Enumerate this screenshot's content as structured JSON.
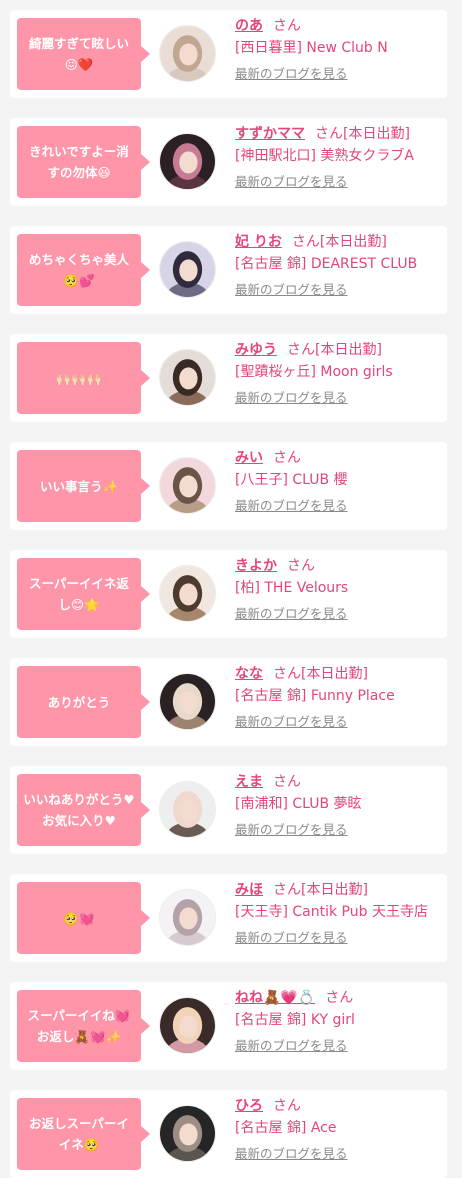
{
  "entries": [
    {
      "comment": "綺麗すぎて眩しい😖❤️",
      "name": "のあ",
      "status": "さん",
      "shop": "[西日暮里] New Club N",
      "blog_link": "最新のブログを見る",
      "avatar_colors": [
        "#e9ddd6",
        "#d9c8bd",
        "#c1a692"
      ]
    },
    {
      "comment": "きれいですよー消すの勿体😆",
      "name": "すずかママ",
      "status": "さん[本日出勤]",
      "shop": "[神田駅北口] 美熟女クラブA",
      "blog_link": "最新のブログを見る",
      "avatar_colors": [
        "#2b2026",
        "#5a3442",
        "#c77b92"
      ]
    },
    {
      "comment": "めちゃくちゃ美人🥺💕",
      "name": "妃 りお",
      "status": "さん[本日出勤]",
      "shop": "[名古屋 錦] DEAREST CLUB",
      "blog_link": "最新のブログを見る",
      "avatar_colors": [
        "#d8d4e8",
        "#6d6a86",
        "#2f2a3c"
      ]
    },
    {
      "comment": "🙌🏻🙌🏻🙌🏻",
      "name": "みゆう",
      "status": "さん[本日出勤]",
      "shop": "[聖蹟桜ヶ丘] Moon girls",
      "blog_link": "最新のブログを見る",
      "avatar_colors": [
        "#e4dcd6",
        "#8a6a58",
        "#3a2a24"
      ]
    },
    {
      "comment": "いい事言う✨",
      "name": "みい",
      "status": "さん",
      "shop": "[八王子] CLUB 櫻",
      "blog_link": "最新のブログを見る",
      "avatar_colors": [
        "#f2d8dd",
        "#b89e86",
        "#6a5447"
      ]
    },
    {
      "comment": "スーパーイイネ返し😊🌟",
      "name": "きよか",
      "status": "さん",
      "shop": "[柏] THE Velours",
      "blog_link": "最新のブログを見る",
      "avatar_colors": [
        "#efe7e0",
        "#a7876c",
        "#4e3a2e"
      ]
    },
    {
      "comment": "ありがとう",
      "name": "なな",
      "status": "さん[本日出勤]",
      "shop": "[名古屋 錦] Funny Place",
      "blog_link": "最新のブログを見る",
      "avatar_colors": [
        "#2a2222",
        "#9e8270",
        "#e7d9cc"
      ]
    },
    {
      "comment": "いいねありがとう♥お気に入り♥",
      "name": "えま",
      "status": "さん",
      "shop": "[南浦和] CLUB 夢眩",
      "blog_link": "最新のブログを見る",
      "avatar_colors": [
        "#eeeeee",
        "#6a5a54",
        "#f0d8cf"
      ]
    },
    {
      "comment": "🥺💓",
      "name": "みほ",
      "status": "さん[本日出勤]",
      "shop": "[天王寺] Cantik Pub 天王寺店",
      "blog_link": "最新のブログを見る",
      "avatar_colors": [
        "#f4f2f4",
        "#d6c9cf",
        "#b3a2aa"
      ]
    },
    {
      "comment": "スーパーイイね💓お返し🧸💓✨",
      "name": "ねね🧸💗💍",
      "status": "さん",
      "shop": "[名古屋 錦] KY girl",
      "blog_link": "最新のブログを見る",
      "avatar_colors": [
        "#3a2a2a",
        "#d39aa5",
        "#f2d3b8"
      ]
    },
    {
      "comment": "お返しスーパーイイネ🥺",
      "name": "ひろ",
      "status": "さん",
      "shop": "[名古屋 錦] Ace",
      "blog_link": "最新のブログを見る",
      "avatar_colors": [
        "#262626",
        "#5b5550",
        "#9c8e84"
      ]
    }
  ]
}
